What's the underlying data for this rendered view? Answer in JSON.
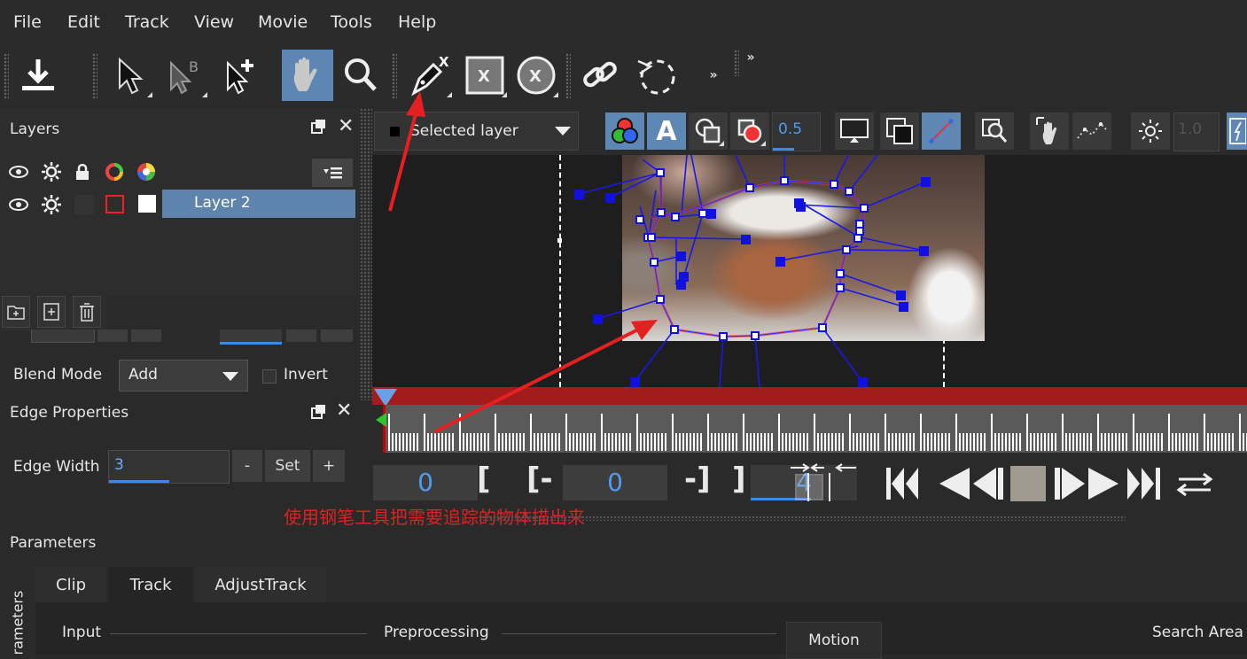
{
  "menubar": {
    "file": "File",
    "edit": "Edit",
    "track": "Track",
    "view": "View",
    "movie": "Movie",
    "tools": "Tools",
    "help": "Help"
  },
  "layers_panel": {
    "title": "Layers",
    "layer_name": "Layer 2"
  },
  "blend": {
    "label": "Blend Mode",
    "value": "Add",
    "invert_label": "Invert"
  },
  "edge": {
    "title": "Edge Properties",
    "width_label": "Edge Width",
    "width_value": "3",
    "minus": "-",
    "set": "Set",
    "plus": "+"
  },
  "viewer_toolbar": {
    "layer_select": "Selected layer",
    "opacity": "0.5",
    "exposure": "1.0",
    "a_label": "A"
  },
  "timecode": {
    "current": "0",
    "open_bracket": "[",
    "in_label": "[-",
    "in_value": "0",
    "out_label": "-]",
    "close_bracket": "]",
    "end_value": "4"
  },
  "annotation": {
    "text": "使用钢笔工具把需要追踪的物体描出来",
    "color": "#e02020"
  },
  "parameters": {
    "title": "Parameters",
    "side_label": "rameters",
    "tabs": [
      "Clip",
      "Track",
      "AdjustTrack"
    ],
    "input_label": "Input",
    "preprocessing_label": "Preprocessing",
    "motion_label": "Motion",
    "search_area_label": "Search Area"
  },
  "colors": {
    "accent": "#5e87b4",
    "timecode": "#4f9cf0",
    "spline": "#1010e0",
    "red_bar": "#a21c1c"
  }
}
